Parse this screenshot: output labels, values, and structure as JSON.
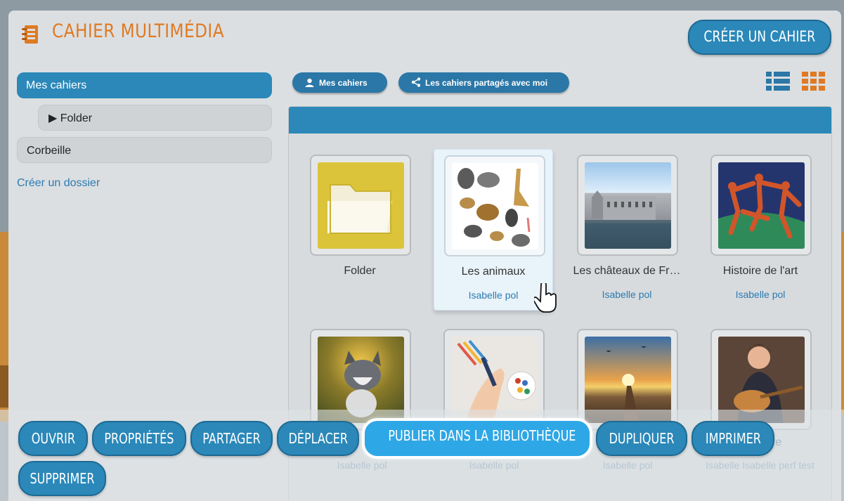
{
  "header": {
    "title": "CAHIER MULTIMÉDIA",
    "create_button": "CRÉER UN CAHIER"
  },
  "sidebar": {
    "items": [
      {
        "label": "Mes cahiers"
      },
      {
        "label": "▶ Folder"
      },
      {
        "label": "Corbeille"
      }
    ],
    "create_folder": "Créer un dossier"
  },
  "filters": {
    "mine": "Mes cahiers",
    "shared": "Les cahiers partagés avec moi"
  },
  "cards": [
    {
      "title": "Folder",
      "author": ""
    },
    {
      "title": "Les animaux",
      "author": "Isabelle pol"
    },
    {
      "title": "Les châteaux de Fr…",
      "author": "Isabelle pol"
    },
    {
      "title": "Histoire de l'art",
      "author": "Isabelle pol"
    },
    {
      "title": "",
      "author": "Isabelle pol"
    },
    {
      "title": "",
      "author": "Isabelle pol"
    },
    {
      "title": "",
      "author": "Isabelle pol"
    },
    {
      "title": "re",
      "author": "Isabelle Isabelle perf test"
    }
  ],
  "actions": {
    "open": "OUVRIR",
    "properties": "PROPRIÉTÉS",
    "share": "PARTAGER",
    "move": "DÉPLACER",
    "publish": "PUBLIER DANS LA BIBLIOTHÈQUE",
    "duplicate": "DUPLIQUER",
    "print": "IMPRIMER",
    "delete": "SUPPRIMER"
  },
  "colors": {
    "accent": "#2b88b9",
    "title_orange": "#e07a22",
    "link_blue": "#2b7bb0"
  }
}
